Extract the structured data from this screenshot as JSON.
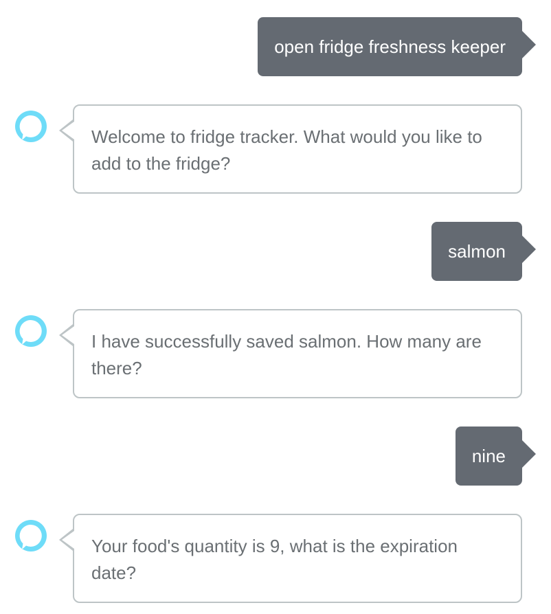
{
  "conversation": {
    "messages": [
      {
        "sender": "user",
        "text": "open fridge freshness keeper"
      },
      {
        "sender": "alexa",
        "text": "Welcome to fridge tracker. What would you like to add to the fridge?"
      },
      {
        "sender": "user",
        "text": "salmon"
      },
      {
        "sender": "alexa",
        "text": "I have successfully saved salmon. How many are there?"
      },
      {
        "sender": "user",
        "text": "nine"
      },
      {
        "sender": "alexa",
        "text": "Your food's quantity is 9, what is the expiration date?"
      }
    ]
  },
  "colors": {
    "user_bubble": "#646a72",
    "alexa_border": "#bdc4c6",
    "alexa_text": "#6a6f73",
    "alexa_icon": "#6edcf8"
  },
  "icons": {
    "assistant": "alexa-ring-icon"
  }
}
